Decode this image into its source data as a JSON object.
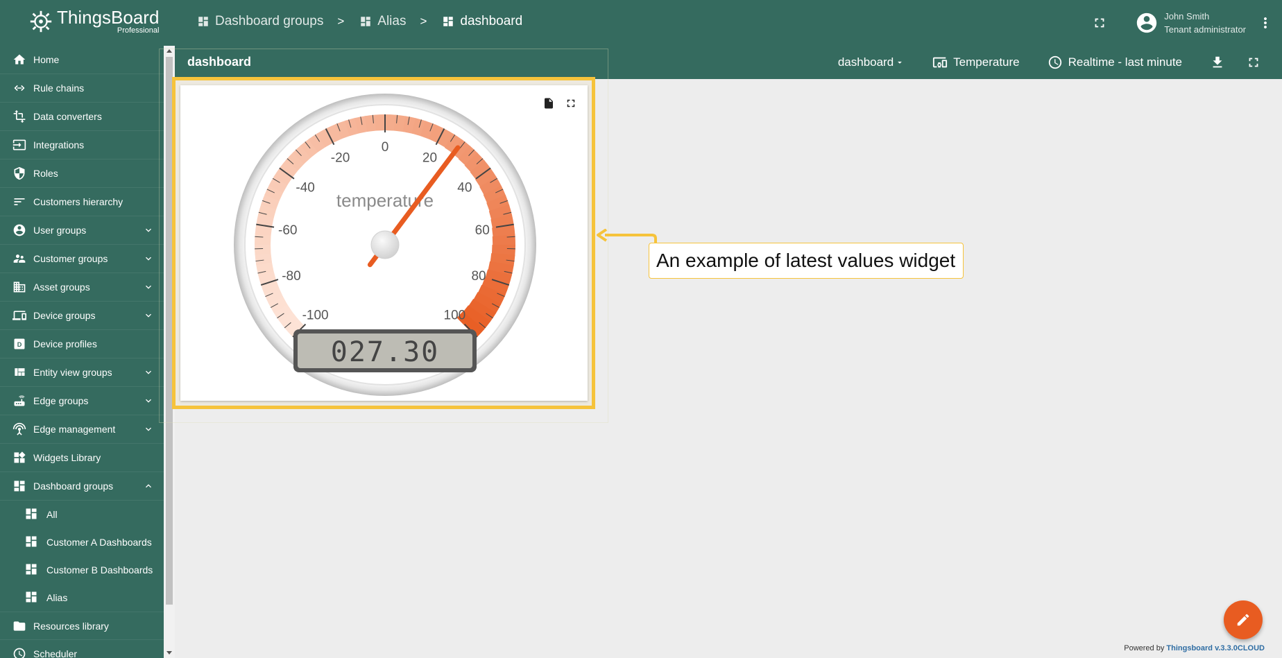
{
  "app": {
    "name": "ThingsBoard",
    "edition": "Professional"
  },
  "breadcrumb": [
    {
      "label": "Dashboard groups"
    },
    {
      "label": "Alias"
    },
    {
      "label": "dashboard"
    }
  ],
  "breadcrumb_separator": ">",
  "user": {
    "name": "John Smith",
    "role": "Tenant administrator"
  },
  "dashboard": {
    "title": "dashboard",
    "state_selector": "dashboard",
    "entity_alias": "Temperature",
    "timewindow": "Realtime - last minute"
  },
  "sidebar": {
    "items": [
      {
        "label": "Home",
        "icon": "home-icon"
      },
      {
        "label": "Rule chains",
        "icon": "rule-chain-icon"
      },
      {
        "label": "Data converters",
        "icon": "transform-icon"
      },
      {
        "label": "Integrations",
        "icon": "input-icon"
      },
      {
        "label": "Roles",
        "icon": "shield-icon"
      },
      {
        "label": "Customers hierarchy",
        "icon": "sort-icon"
      },
      {
        "label": "User groups",
        "icon": "account-icon"
      },
      {
        "label": "Customer groups",
        "icon": "supervisor-icon"
      },
      {
        "label": "Asset groups",
        "icon": "domain-icon"
      },
      {
        "label": "Device groups",
        "icon": "devices-icon"
      },
      {
        "label": "Device profiles",
        "icon": "device-profile-icon"
      },
      {
        "label": "Entity view groups",
        "icon": "view-quilt-icon"
      },
      {
        "label": "Edge groups",
        "icon": "router-icon"
      },
      {
        "label": "Edge management",
        "icon": "settings-input-antenna-icon"
      },
      {
        "label": "Widgets Library",
        "icon": "widgets-icon"
      },
      {
        "label": "Dashboard groups",
        "icon": "dashboard-icon"
      }
    ],
    "sub_items": [
      {
        "label": "All"
      },
      {
        "label": "Customer A Dashboards"
      },
      {
        "label": "Customer B Dashboards"
      },
      {
        "label": "Alias"
      }
    ],
    "bottom_items": [
      {
        "label": "Resources library",
        "icon": "folder-icon"
      },
      {
        "label": "Scheduler",
        "icon": "schedule-icon"
      }
    ]
  },
  "widget": {
    "label": "temperature",
    "value": 27.3,
    "lcd_text": "027.30",
    "min": -100,
    "max": 100,
    "tick_labels": [
      "-100",
      "-80",
      "-60",
      "-40",
      "-20",
      "0",
      "20",
      "40",
      "60",
      "80",
      "100"
    ],
    "colors": {
      "bar_low": "#fde3d6",
      "bar_high": "#e85c21",
      "needle": "#e85c21",
      "lcd_bg": "#bdbcb4"
    }
  },
  "callout": {
    "text": "An example of latest values widget"
  },
  "footer": {
    "prefix": "Powered by",
    "link": "Thingsboard v.3.3.0CLOUD"
  },
  "colors": {
    "primary": "#356b5f",
    "accent": "#e85c21",
    "highlight": "#f6c33b"
  }
}
